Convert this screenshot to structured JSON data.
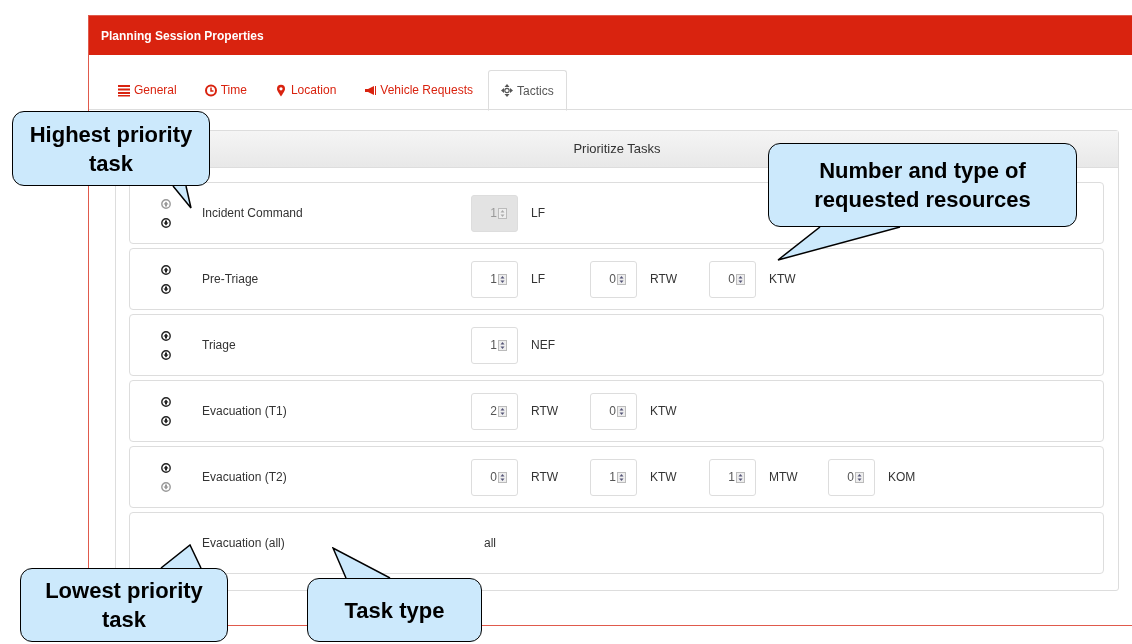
{
  "window": {
    "title": "Planning Session Properties"
  },
  "tabs": [
    {
      "label": "General",
      "selected": false
    },
    {
      "label": "Time",
      "selected": false
    },
    {
      "label": "Location",
      "selected": false
    },
    {
      "label": "Vehicle Requests",
      "selected": false
    },
    {
      "label": "Tactics",
      "selected": true
    }
  ],
  "panel": {
    "title": "Prioritize Tasks"
  },
  "tasks": [
    {
      "name": "Incident Command",
      "kind": "resources",
      "up_enabled": false,
      "down_enabled": true,
      "resources": [
        {
          "value": "1",
          "unit": "LF",
          "disabled": true
        }
      ]
    },
    {
      "name": "Pre-Triage",
      "kind": "resources",
      "up_enabled": true,
      "down_enabled": true,
      "resources": [
        {
          "value": "1",
          "unit": "LF",
          "disabled": false
        },
        {
          "value": "0",
          "unit": "RTW",
          "disabled": false
        },
        {
          "value": "0",
          "unit": "KTW",
          "disabled": false
        }
      ]
    },
    {
      "name": "Triage",
      "kind": "resources",
      "up_enabled": true,
      "down_enabled": true,
      "resources": [
        {
          "value": "1",
          "unit": "NEF",
          "disabled": false
        }
      ]
    },
    {
      "name": "Evacuation (T1)",
      "kind": "resources",
      "up_enabled": true,
      "down_enabled": true,
      "resources": [
        {
          "value": "2",
          "unit": "RTW",
          "disabled": false
        },
        {
          "value": "0",
          "unit": "KTW",
          "disabled": false
        }
      ]
    },
    {
      "name": "Evacuation (T2)",
      "kind": "resources",
      "up_enabled": true,
      "down_enabled": false,
      "resources": [
        {
          "value": "0",
          "unit": "RTW",
          "disabled": false
        },
        {
          "value": "1",
          "unit": "KTW",
          "disabled": false
        },
        {
          "value": "1",
          "unit": "MTW",
          "disabled": false
        },
        {
          "value": "0",
          "unit": "KOM",
          "disabled": false
        }
      ]
    },
    {
      "name": "Evacuation (all)",
      "kind": "all",
      "text": "all"
    }
  ],
  "callouts": [
    {
      "text": "Highest priority task"
    },
    {
      "text": "Number and type of requested resources"
    },
    {
      "text": "Lowest priority task"
    },
    {
      "text": "Task type"
    }
  ]
}
